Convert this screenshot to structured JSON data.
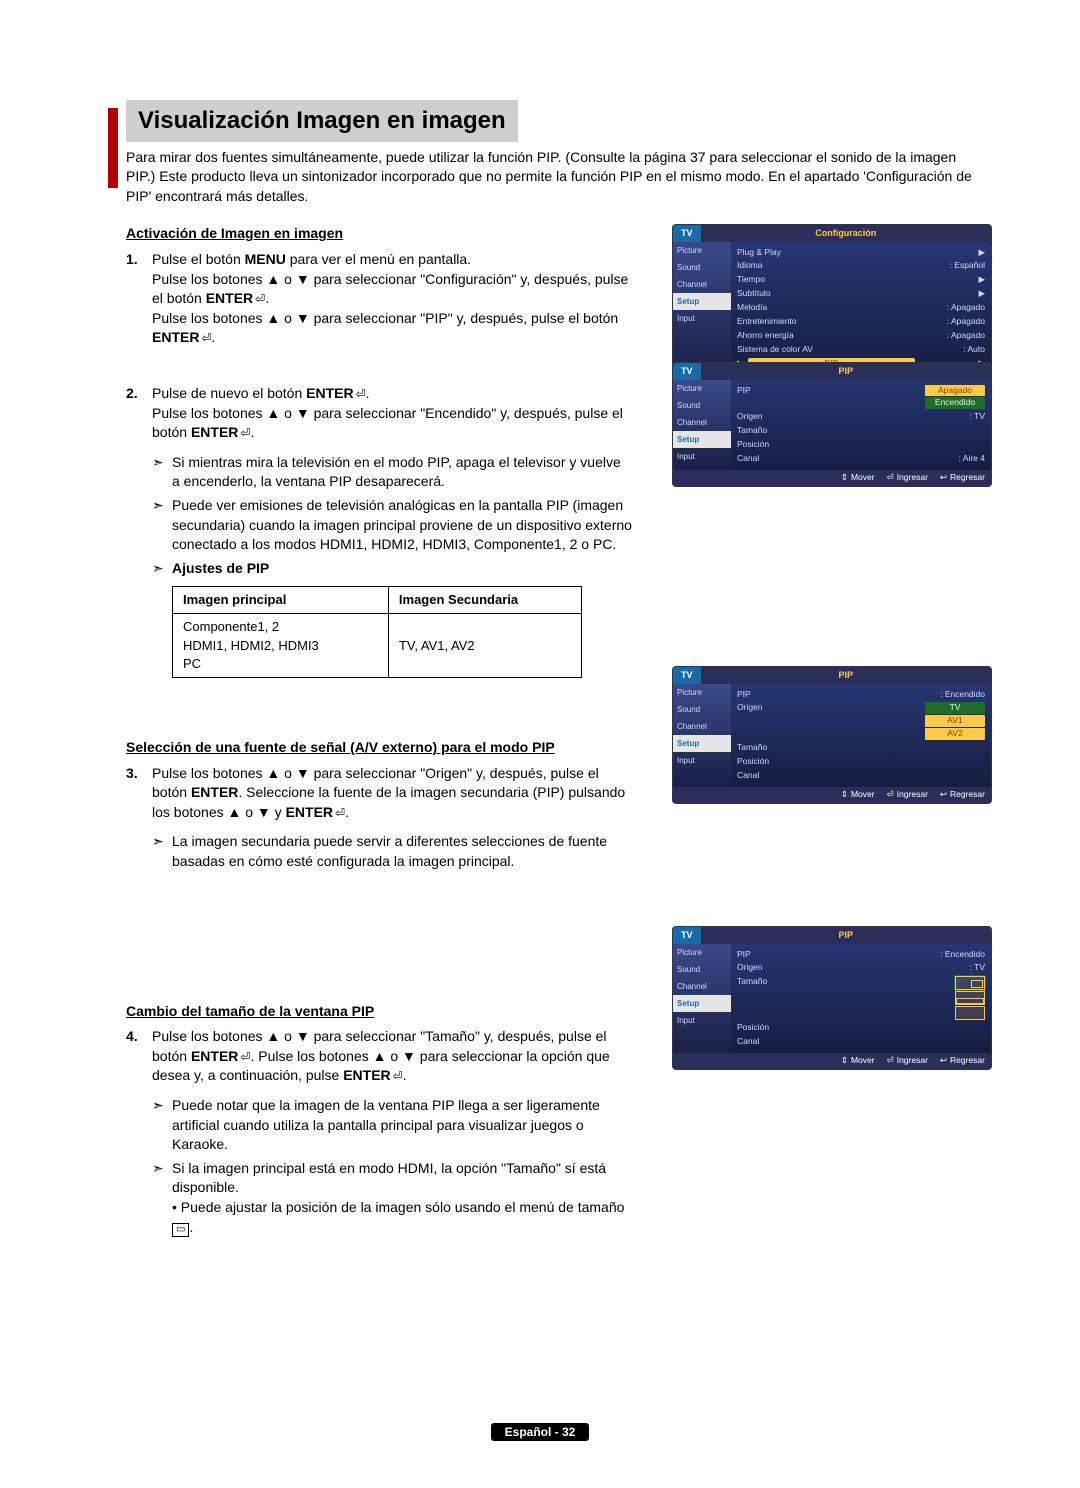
{
  "page_title": "Visualización Imagen en imagen",
  "intro": "Para mirar dos fuentes simultáneamente, puede utilizar la función PIP. (Consulte la página 37 para seleccionar el sonido de la imagen PIP.) Este producto lleva un sintonizador incorporado que no permite la función PIP en el mismo modo. En el apartado 'Configuración de PIP' encontrará más detalles.",
  "sec1_heading": "Activación de Imagen en imagen",
  "step1": {
    "num": "1.",
    "line1_a": "Pulse el botón ",
    "line1_menu": "MENU",
    "line1_b": " para ver el menú en pantalla.",
    "line2_a": "Pulse los botones ▲ o ▼ para seleccionar \"Configuración\" y, después, pulse el botón ",
    "line2_enter": "ENTER",
    "line2_c": ".",
    "line3_a": "Pulse los botones ▲ o ▼ para seleccionar \"PIP\" y, después, pulse el botón ",
    "line3_enter": "ENTER",
    "line3_c": "."
  },
  "step2": {
    "num": "2.",
    "line1_a": "Pulse de nuevo el botón ",
    "line1_enter": "ENTER",
    "line1_c": ".",
    "line2_a": "Pulse los botones ▲ o ▼ para seleccionar \"Encendido\" y, después, pulse el botón ",
    "line2_enter": "ENTER",
    "line2_c": ".",
    "bullet1": "Si mientras mira la televisión en el modo PIP, apaga el televisor y vuelve a encenderlo, la ventana PIP desaparecerá.",
    "bullet2": "Puede ver emisiones de televisión analógicas en la pantalla PIP (imagen secundaria) cuando la imagen principal proviene de un dispositivo externo conectado a los modos HDMI1, HDMI2, HDMI3, Componente1, 2 o PC.",
    "ajustes": "Ajustes de PIP"
  },
  "table": {
    "h1": "Imagen principal",
    "h2": "Imagen Secundaria",
    "c1": "Componente1, 2\nHDMI1, HDMI2, HDMI3\nPC",
    "c2": "TV, AV1, AV2"
  },
  "sec2_heading": "Selección de una fuente de señal (A/V externo) para el modo PIP",
  "step3": {
    "num": "3.",
    "line1_a": "Pulse los botones ▲ o ▼ para seleccionar \"Origen\" y, después, pulse el botón ",
    "line1_enter": "ENTER",
    "line1_c": ". Seleccione la fuente de la imagen secundaria (PIP) pulsando los botones ▲ o ▼ y ",
    "line1_enter2": "ENTER",
    "line1_e": ".",
    "bullet1": "La imagen secundaria puede servir a diferentes selecciones de fuente basadas en cómo esté configurada la imagen principal."
  },
  "sec3_heading": "Cambio del tamaño de la ventana PIP",
  "step4": {
    "num": "4.",
    "line1_a": "Pulse los botones ▲ o ▼ para seleccionar \"Tamaño\" y, después, pulse el botón ",
    "line1_enter": "ENTER",
    "line1_c": ". Pulse los botones ▲ o ▼ para seleccionar la opción que desea y, a continuación, pulse ",
    "line1_enter2": "ENTER",
    "line1_e": ".",
    "bullet1": "Puede notar que la imagen de la ventana PIP llega a ser ligeramente artificial cuando utiliza la pantalla principal para visualizar juegos o Karaoke.",
    "bullet2_a": "Si la imagen principal está en modo HDMI, la opción \"Tamaño\" sí está disponible.",
    "bullet2_b": "• Puede ajustar la posición de la imagen sólo usando el menú de tamaño "
  },
  "osd1": {
    "tv": "TV",
    "title": "Configuración",
    "side": [
      "Picture",
      "Sound",
      "Channel",
      "Setup",
      "Input"
    ],
    "rows": [
      {
        "l": "Plug & Play",
        "v": "▶"
      },
      {
        "l": "Idioma",
        "v": ": Español"
      },
      {
        "l": "Tiempo",
        "v": "▶"
      },
      {
        "l": "Subtítulo",
        "v": "▶"
      },
      {
        "l": "Melodía",
        "v": ": Apagado"
      },
      {
        "l": "Entretenimiento",
        "v": ": Apagado"
      },
      {
        "l": "Ahorro energía",
        "v": ": Apagado"
      },
      {
        "l": "Sistema de color AV",
        "v": ": Auto"
      },
      {
        "l": "PIP",
        "v": "▶",
        "hl": true
      }
    ],
    "footer": {
      "m": "Mover",
      "e": "Ingresar",
      "r": "Regresar"
    }
  },
  "osd2": {
    "tv": "TV",
    "title": "PIP",
    "side": [
      "Picture",
      "Sound",
      "Channel",
      "Setup",
      "Input"
    ],
    "rows": [
      {
        "l": "PIP",
        "opts": [
          "Apagado",
          "Encendido"
        ]
      },
      {
        "l": "Origen",
        "v": ": TV"
      },
      {
        "l": "Tamaño",
        "v": ""
      },
      {
        "l": "Posición",
        "v": ""
      },
      {
        "l": "Canal",
        "v": ": Aire       4"
      }
    ],
    "footer": {
      "m": "Mover",
      "e": "Ingresar",
      "r": "Regresar"
    }
  },
  "osd3": {
    "tv": "TV",
    "title": "PIP",
    "side": [
      "Picture",
      "Sound",
      "Channel",
      "Setup",
      "Input"
    ],
    "rows": [
      {
        "l": "PIP",
        "v": ": Encendido"
      },
      {
        "l": "Origen",
        "opts": [
          "TV",
          "AV1",
          "AV2"
        ]
      },
      {
        "l": "Tamaño",
        "v": ""
      },
      {
        "l": "Posición",
        "v": ""
      },
      {
        "l": "Canal",
        "v": ""
      }
    ],
    "footer": {
      "m": "Mover",
      "e": "Ingresar",
      "r": "Regresar"
    }
  },
  "osd4": {
    "tv": "TV",
    "title": "PIP",
    "side": [
      "Picture",
      "Sound",
      "Channel",
      "Setup",
      "Input"
    ],
    "rows": [
      {
        "l": "PIP",
        "v": ": Encendido"
      },
      {
        "l": "Origen",
        "v": ": TV"
      },
      {
        "l": "Tamaño",
        "shapes": [
          "s1",
          "s2",
          "s3"
        ]
      },
      {
        "l": "Posición",
        "v": ""
      },
      {
        "l": "Canal",
        "v": ""
      }
    ],
    "footer": {
      "m": "Mover",
      "e": "Ingresar",
      "r": "Regresar"
    }
  },
  "footer": "Español - 32"
}
